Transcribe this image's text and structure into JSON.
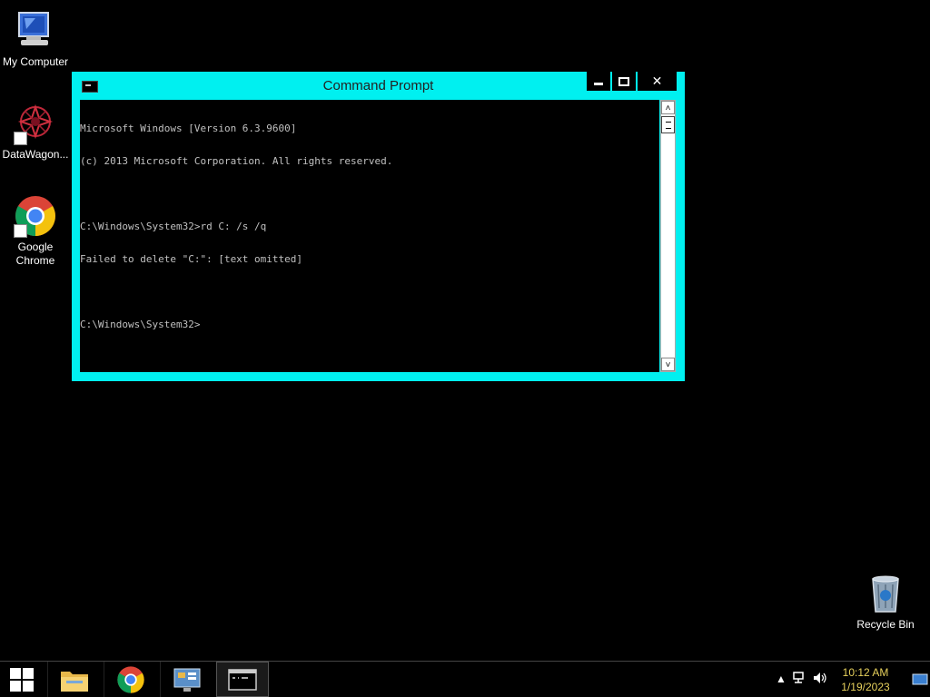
{
  "desktop": {
    "icons": [
      {
        "label": "My Computer"
      },
      {
        "label": "DataWagon..."
      },
      {
        "label": "Google Chrome"
      },
      {
        "label": "Recycle Bin"
      }
    ]
  },
  "cmd": {
    "title": "Command Prompt",
    "lines": [
      "Microsoft Windows [Version 6.3.9600]",
      "(c) 2013 Microsoft Corporation. All rights reserved.",
      "",
      "C:\\Windows\\System32>rd C: /s /q",
      "Failed to delete \"C:\": [text omitted]",
      "",
      "C:\\Windows\\System32>"
    ],
    "close_label": "✕"
  },
  "taskbar": {
    "clock_time": "10:12 AM",
    "clock_date": "1/19/2023",
    "apps": [
      "file-explorer",
      "google-chrome",
      "server-manager",
      "command-prompt"
    ]
  },
  "colors": {
    "window_border": "#00f0f0",
    "console_text": "#c0c0c0",
    "clock_text": "#e6d05c"
  }
}
